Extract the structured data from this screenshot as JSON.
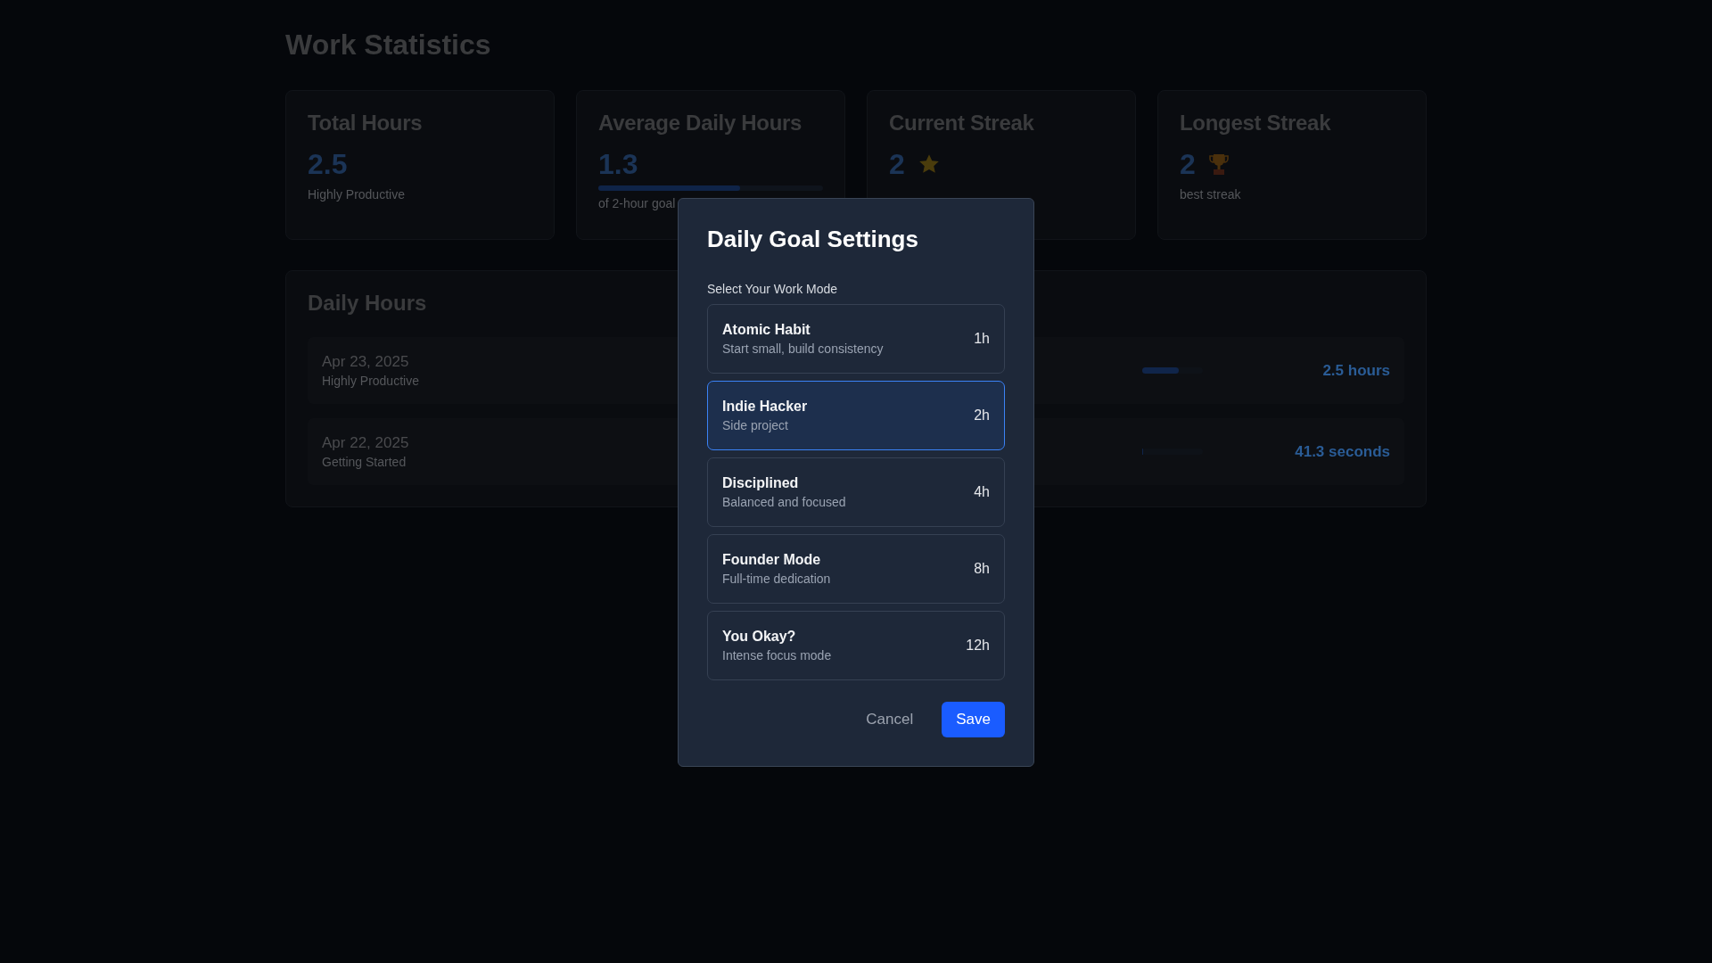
{
  "page_title": "Work Statistics",
  "stats": [
    {
      "title": "Total Hours",
      "value": "2.5",
      "caption": "Highly Productive",
      "kind": "plain"
    },
    {
      "title": "Average Daily Hours",
      "value": "1.3",
      "caption": "of 2-hour goal",
      "kind": "progress",
      "level": 0.63
    },
    {
      "title": "Current Streak",
      "value": "2",
      "kind": "star"
    },
    {
      "title": "Longest Streak",
      "value": "2",
      "caption": "best streak",
      "kind": "trophy"
    }
  ],
  "daily_hours": {
    "title": "Daily Hours",
    "rows": [
      {
        "date": "Apr 23, 2025",
        "caption": "Highly Productive",
        "level": 0.6,
        "amount": "2.5 hours"
      },
      {
        "date": "Apr 22, 2025",
        "caption": "Getting Started",
        "level": 0.02,
        "amount": "41.3 seconds"
      }
    ]
  },
  "modal": {
    "title": "Daily Goal Settings",
    "label": "Select Your Work Mode",
    "options": [
      {
        "name": "Atomic Habit",
        "description": "Start small, build consistency",
        "hours": "1h",
        "selected": false
      },
      {
        "name": "Indie Hacker",
        "description": "Side project",
        "hours": "2h",
        "selected": true
      },
      {
        "name": "Disciplined",
        "description": "Balanced and focused",
        "hours": "4h",
        "selected": false
      },
      {
        "name": "Founder Mode",
        "description": "Full-time dedication",
        "hours": "8h",
        "selected": false
      },
      {
        "name": "You Okay?",
        "description": "Intense focus mode",
        "hours": "12h",
        "selected": false
      }
    ],
    "buttons": [
      {
        "label": "Cancel",
        "kind": "secondary"
      },
      {
        "label": "Save",
        "kind": "primary"
      }
    ]
  }
}
